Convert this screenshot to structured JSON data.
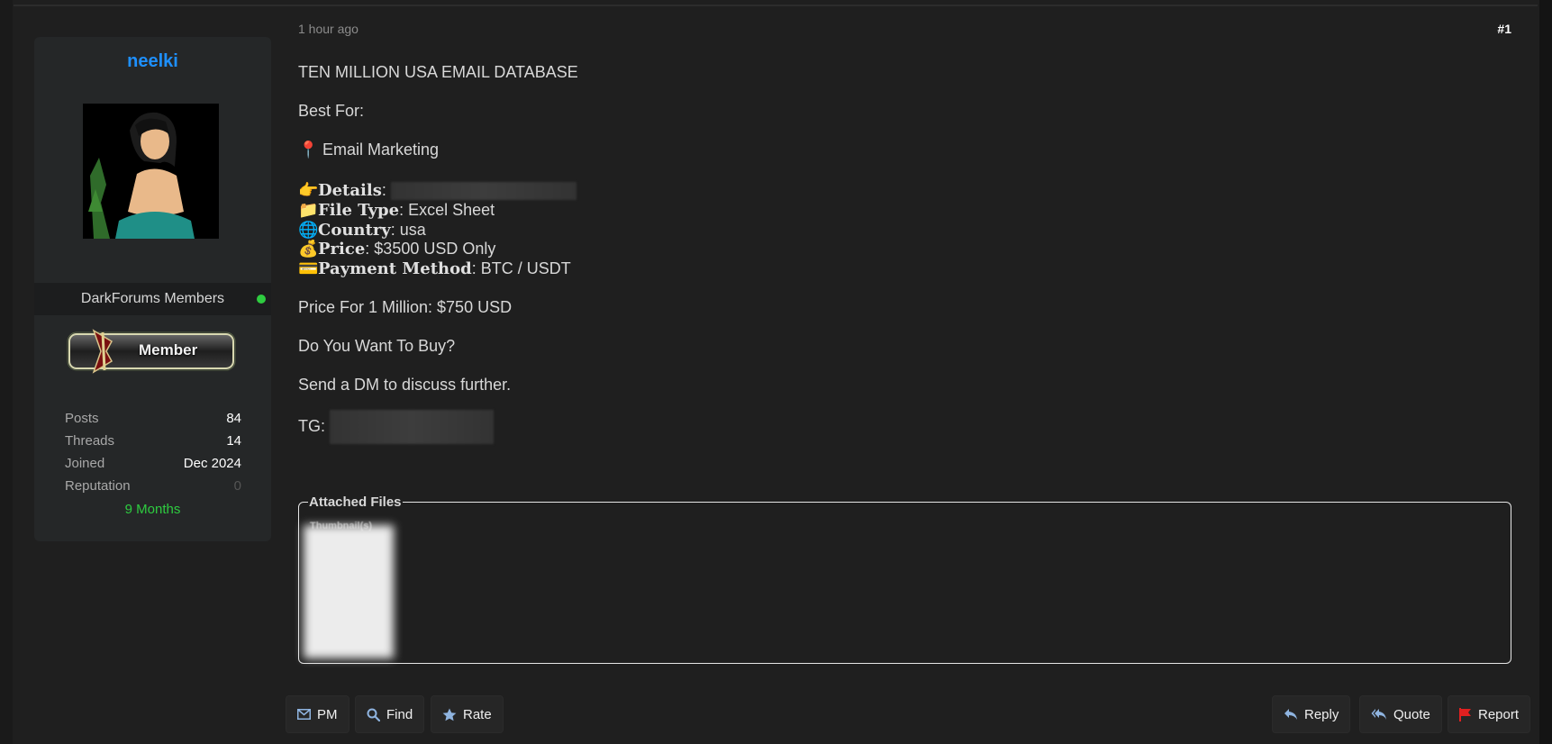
{
  "post": {
    "time": "1 hour ago",
    "number": "#1",
    "title": "TEN MILLION USA EMAIL DATABASE",
    "best_for_label": "Best For:",
    "best_for_item": "Email Marketing",
    "details_key": "Details",
    "file_type_key": "File Type",
    "file_type_value": "Excel Sheet",
    "country_key": "Country",
    "country_value": "usa",
    "price_key": "Price",
    "price_value": "$3500 USD Only",
    "payment_key": "Payment Method",
    "payment_value": "BTC / USDT",
    "price_million": "Price For 1 Million: $750 USD",
    "question": "Do You Want To Buy?",
    "cta": "Send a DM to discuss further.",
    "tg_label": "TG:"
  },
  "icons": {
    "pin": "📍",
    "point": "👉",
    "folder": "📁",
    "globe": "🌐",
    "money": "💰",
    "card": "💳"
  },
  "user": {
    "name": "neelki",
    "group": "DarkForums Members",
    "rank": "Member",
    "tenure": "9 Months",
    "stats": [
      {
        "label": "Posts",
        "value": "84"
      },
      {
        "label": "Threads",
        "value": "14"
      },
      {
        "label": "Joined",
        "value": "Dec 2024"
      },
      {
        "label": "Reputation",
        "value": "0"
      }
    ]
  },
  "attachments": {
    "legend": "Attached Files",
    "thumbnails_label": "Thumbnail(s)"
  },
  "buttons": {
    "pm": "PM",
    "find": "Find",
    "rate": "Rate",
    "reply": "Reply",
    "quote": "Quote",
    "report": "Report"
  },
  "colors": {
    "username": "#1e90ff",
    "online": "#2ecc40",
    "report_flag": "#e02020",
    "button_icon": "#8fb4e0"
  }
}
